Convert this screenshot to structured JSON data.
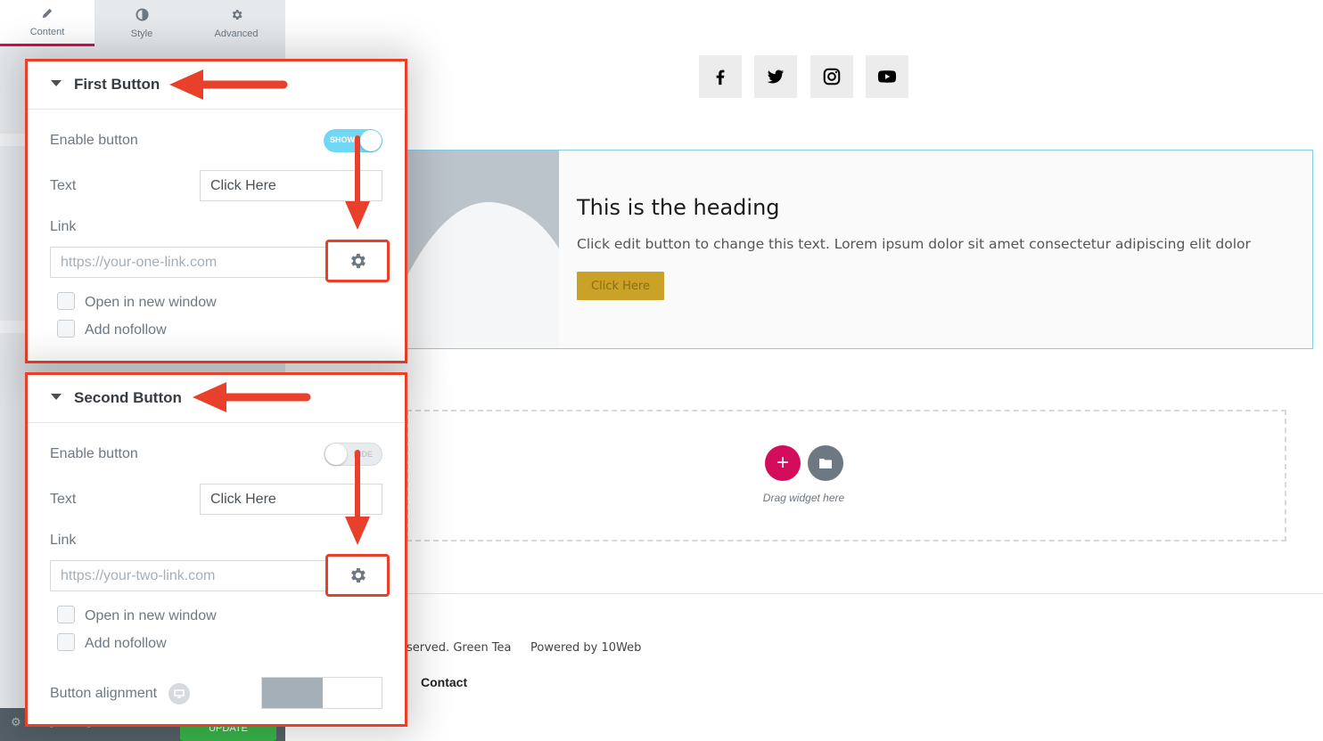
{
  "sidebar": {
    "tabs": [
      {
        "label": "Content",
        "icon": "pencil-icon"
      },
      {
        "label": "Style",
        "icon": "contrast-icon"
      },
      {
        "label": "Advanced",
        "icon": "gear-icon"
      }
    ],
    "footer": {
      "update_label": "UPDATE"
    }
  },
  "first_button": {
    "title": "First Button",
    "enable_label": "Enable button",
    "enable_state": "SHOW",
    "enable_on": true,
    "text_label": "Text",
    "text_value": "Click Here",
    "link_label": "Link",
    "link_placeholder": "https://your-one-link.com",
    "open_new_window": "Open in new window",
    "add_nofollow": "Add nofollow"
  },
  "second_button": {
    "title": "Second Button",
    "enable_label": "Enable button",
    "enable_state": "HIDE",
    "enable_on": false,
    "text_label": "Text",
    "text_value": "Click Here",
    "link_label": "Link",
    "link_placeholder": "https://your-two-link.com",
    "open_new_window": "Open in new window",
    "add_nofollow": "Add nofollow",
    "alignment_label": "Button alignment"
  },
  "preview": {
    "social_icons": [
      "facebook-icon",
      "twitter-icon",
      "instagram-icon",
      "youtube-icon"
    ],
    "hero": {
      "heading": "This is the heading",
      "text": "Click edit button to change this text. Lorem ipsum dolor sit amet consectetur adipiscing elit dolor",
      "button": "Click Here"
    },
    "dropzone": {
      "hint": "Drag widget here"
    },
    "footer": {
      "copyright": "served. Green Tea",
      "powered": "Powered by 10Web",
      "contact": "Contact"
    }
  },
  "colors": {
    "highlight": "#e8402a",
    "accent": "#d30c5c",
    "toggle_on": "#71d7f7",
    "hero_button": "#c9a227"
  }
}
